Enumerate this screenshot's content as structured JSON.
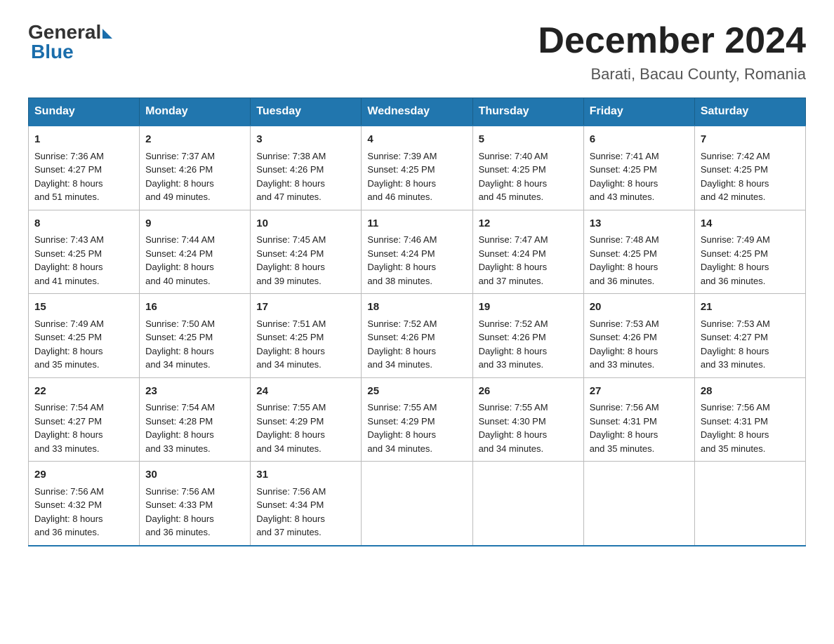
{
  "logo": {
    "general": "General",
    "blue": "Blue"
  },
  "title": "December 2024",
  "location": "Barati, Bacau County, Romania",
  "days_of_week": [
    "Sunday",
    "Monday",
    "Tuesday",
    "Wednesday",
    "Thursday",
    "Friday",
    "Saturday"
  ],
  "weeks": [
    [
      {
        "day": "1",
        "sunrise": "7:36 AM",
        "sunset": "4:27 PM",
        "daylight": "8 hours and 51 minutes."
      },
      {
        "day": "2",
        "sunrise": "7:37 AM",
        "sunset": "4:26 PM",
        "daylight": "8 hours and 49 minutes."
      },
      {
        "day": "3",
        "sunrise": "7:38 AM",
        "sunset": "4:26 PM",
        "daylight": "8 hours and 47 minutes."
      },
      {
        "day": "4",
        "sunrise": "7:39 AM",
        "sunset": "4:25 PM",
        "daylight": "8 hours and 46 minutes."
      },
      {
        "day": "5",
        "sunrise": "7:40 AM",
        "sunset": "4:25 PM",
        "daylight": "8 hours and 45 minutes."
      },
      {
        "day": "6",
        "sunrise": "7:41 AM",
        "sunset": "4:25 PM",
        "daylight": "8 hours and 43 minutes."
      },
      {
        "day": "7",
        "sunrise": "7:42 AM",
        "sunset": "4:25 PM",
        "daylight": "8 hours and 42 minutes."
      }
    ],
    [
      {
        "day": "8",
        "sunrise": "7:43 AM",
        "sunset": "4:25 PM",
        "daylight": "8 hours and 41 minutes."
      },
      {
        "day": "9",
        "sunrise": "7:44 AM",
        "sunset": "4:24 PM",
        "daylight": "8 hours and 40 minutes."
      },
      {
        "day": "10",
        "sunrise": "7:45 AM",
        "sunset": "4:24 PM",
        "daylight": "8 hours and 39 minutes."
      },
      {
        "day": "11",
        "sunrise": "7:46 AM",
        "sunset": "4:24 PM",
        "daylight": "8 hours and 38 minutes."
      },
      {
        "day": "12",
        "sunrise": "7:47 AM",
        "sunset": "4:24 PM",
        "daylight": "8 hours and 37 minutes."
      },
      {
        "day": "13",
        "sunrise": "7:48 AM",
        "sunset": "4:25 PM",
        "daylight": "8 hours and 36 minutes."
      },
      {
        "day": "14",
        "sunrise": "7:49 AM",
        "sunset": "4:25 PM",
        "daylight": "8 hours and 36 minutes."
      }
    ],
    [
      {
        "day": "15",
        "sunrise": "7:49 AM",
        "sunset": "4:25 PM",
        "daylight": "8 hours and 35 minutes."
      },
      {
        "day": "16",
        "sunrise": "7:50 AM",
        "sunset": "4:25 PM",
        "daylight": "8 hours and 34 minutes."
      },
      {
        "day": "17",
        "sunrise": "7:51 AM",
        "sunset": "4:25 PM",
        "daylight": "8 hours and 34 minutes."
      },
      {
        "day": "18",
        "sunrise": "7:52 AM",
        "sunset": "4:26 PM",
        "daylight": "8 hours and 34 minutes."
      },
      {
        "day": "19",
        "sunrise": "7:52 AM",
        "sunset": "4:26 PM",
        "daylight": "8 hours and 33 minutes."
      },
      {
        "day": "20",
        "sunrise": "7:53 AM",
        "sunset": "4:26 PM",
        "daylight": "8 hours and 33 minutes."
      },
      {
        "day": "21",
        "sunrise": "7:53 AM",
        "sunset": "4:27 PM",
        "daylight": "8 hours and 33 minutes."
      }
    ],
    [
      {
        "day": "22",
        "sunrise": "7:54 AM",
        "sunset": "4:27 PM",
        "daylight": "8 hours and 33 minutes."
      },
      {
        "day": "23",
        "sunrise": "7:54 AM",
        "sunset": "4:28 PM",
        "daylight": "8 hours and 33 minutes."
      },
      {
        "day": "24",
        "sunrise": "7:55 AM",
        "sunset": "4:29 PM",
        "daylight": "8 hours and 34 minutes."
      },
      {
        "day": "25",
        "sunrise": "7:55 AM",
        "sunset": "4:29 PM",
        "daylight": "8 hours and 34 minutes."
      },
      {
        "day": "26",
        "sunrise": "7:55 AM",
        "sunset": "4:30 PM",
        "daylight": "8 hours and 34 minutes."
      },
      {
        "day": "27",
        "sunrise": "7:56 AM",
        "sunset": "4:31 PM",
        "daylight": "8 hours and 35 minutes."
      },
      {
        "day": "28",
        "sunrise": "7:56 AM",
        "sunset": "4:31 PM",
        "daylight": "8 hours and 35 minutes."
      }
    ],
    [
      {
        "day": "29",
        "sunrise": "7:56 AM",
        "sunset": "4:32 PM",
        "daylight": "8 hours and 36 minutes."
      },
      {
        "day": "30",
        "sunrise": "7:56 AM",
        "sunset": "4:33 PM",
        "daylight": "8 hours and 36 minutes."
      },
      {
        "day": "31",
        "sunrise": "7:56 AM",
        "sunset": "4:34 PM",
        "daylight": "8 hours and 37 minutes."
      },
      null,
      null,
      null,
      null
    ]
  ],
  "labels": {
    "sunrise": "Sunrise:",
    "sunset": "Sunset:",
    "daylight": "Daylight:"
  }
}
